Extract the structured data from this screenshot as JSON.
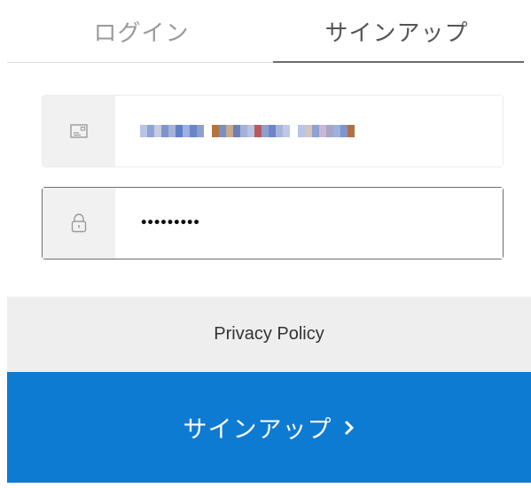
{
  "tabs": {
    "login_label": "ログイン",
    "signup_label": "サインアップ",
    "active": "signup"
  },
  "form": {
    "email_icon": "email-card-icon",
    "password_icon": "lock-icon",
    "password_value": "•••••••••"
  },
  "privacy": {
    "label": "Privacy Policy"
  },
  "submit": {
    "label": "サインアップ",
    "chevron": "chevron-right-icon"
  },
  "colors": {
    "accent": "#0e7bd2",
    "tab_active_underline": "#6b6b6b",
    "field_icon_bg": "#f1f1f1",
    "privacy_bg": "#eeeeee"
  }
}
